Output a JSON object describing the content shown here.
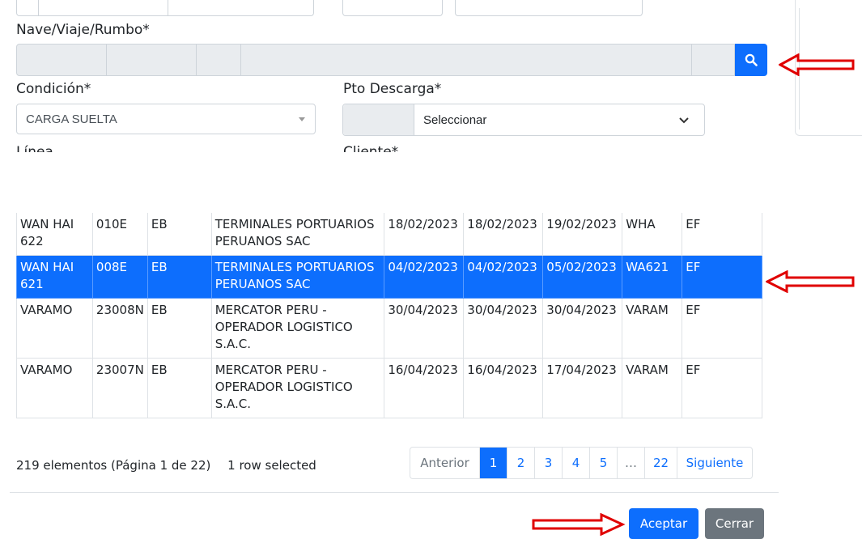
{
  "form": {
    "nave_label": "Nave/Viaje/Rumbo*",
    "condicion_label": "Condición*",
    "condicion_value": "CARGA SUELTA",
    "pto_descarga_label": "Pto Descarga*",
    "pto_descarga_value": "Seleccionar",
    "linea_label": "Línea",
    "cliente_label": "Cliente*"
  },
  "table": {
    "rows": [
      {
        "nave": "WAN HAI 622",
        "viaje": "010E",
        "rumbo": "EB",
        "terminal": "TERMINALES PORTUARIOS PERUANOS SAC",
        "f1": "18/02/2023",
        "f2": "18/02/2023",
        "f3": "19/02/2023",
        "code": "WHA",
        "tipo": "EF"
      },
      {
        "nave": "WAN HAI 621",
        "viaje": "008E",
        "rumbo": "EB",
        "terminal": "TERMINALES PORTUARIOS PERUANOS SAC",
        "f1": "04/02/2023",
        "f2": "04/02/2023",
        "f3": "05/02/2023",
        "code": "WA621",
        "tipo": "EF"
      },
      {
        "nave": "VARAMO",
        "viaje": "23008N",
        "rumbo": "EB",
        "terminal": "MERCATOR PERU - OPERADOR LOGISTICO S.A.C.",
        "f1": "30/04/2023",
        "f2": "30/04/2023",
        "f3": "30/04/2023",
        "code": "VARAM",
        "tipo": "EF"
      },
      {
        "nave": "VARAMO",
        "viaje": "23007N",
        "rumbo": "EB",
        "terminal": "MERCATOR PERU - OPERADOR LOGISTICO S.A.C.",
        "f1": "16/04/2023",
        "f2": "16/04/2023",
        "f3": "17/04/2023",
        "code": "VARAM",
        "tipo": "EF"
      }
    ]
  },
  "footer": {
    "info": "219 elementos (Página 1 de 22)",
    "selected": "1 row selected"
  },
  "pagination": {
    "prev": "Anterior",
    "pages": [
      "1",
      "2",
      "3",
      "4",
      "5"
    ],
    "dots": "…",
    "last": "22",
    "next": "Siguiente"
  },
  "buttons": {
    "accept": "Aceptar",
    "close": "Cerrar"
  },
  "colors": {
    "primary": "#0d6efd",
    "secondary": "#6c757d",
    "annotation_arrow": "#e00000"
  },
  "icons": {
    "search": "search-icon",
    "chevron": "chevron-down-icon",
    "caret": "caret-down-icon",
    "arrow": "red-arrow-annotation"
  }
}
